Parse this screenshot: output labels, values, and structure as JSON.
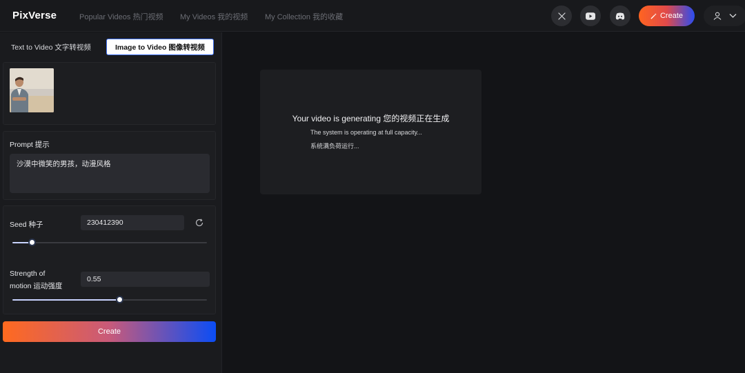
{
  "header": {
    "logo": "PixVerse",
    "nav": [
      "Popular Videos 热门视频",
      "My Videos 我的视频",
      "My Collection 我的收藏"
    ],
    "create_label": "Create"
  },
  "icons": {
    "x": "x-logo-icon",
    "youtube": "youtube-icon",
    "discord": "discord-icon",
    "create": "magic-wand-icon",
    "user": "user-icon",
    "chevron": "chevron-down-icon",
    "refresh": "refresh-icon"
  },
  "tabs": {
    "text_to_video": "Text to Video 文字转视频",
    "image_to_video": "Image to Video 图像转视频"
  },
  "prompt": {
    "label": "Prompt 提示",
    "value": "沙漠中微笑的男孩，动漫风格"
  },
  "seed": {
    "label": "Seed 种子",
    "value": "230412390",
    "slider_fraction": 0.1
  },
  "motion": {
    "label_line1": "Strength of",
    "label_line2": "motion 运动强度",
    "value": "0.55",
    "slider_fraction": 0.55
  },
  "create_button": "Create",
  "status": {
    "title": "Your video is generating 您的视频正在生成",
    "line1": "The system is operating at full capacity...",
    "line2": "系统满负荷运行..."
  },
  "colors": {
    "accent_orange": "#ff6420",
    "accent_blue": "#0b4df5",
    "background": "#131417"
  }
}
